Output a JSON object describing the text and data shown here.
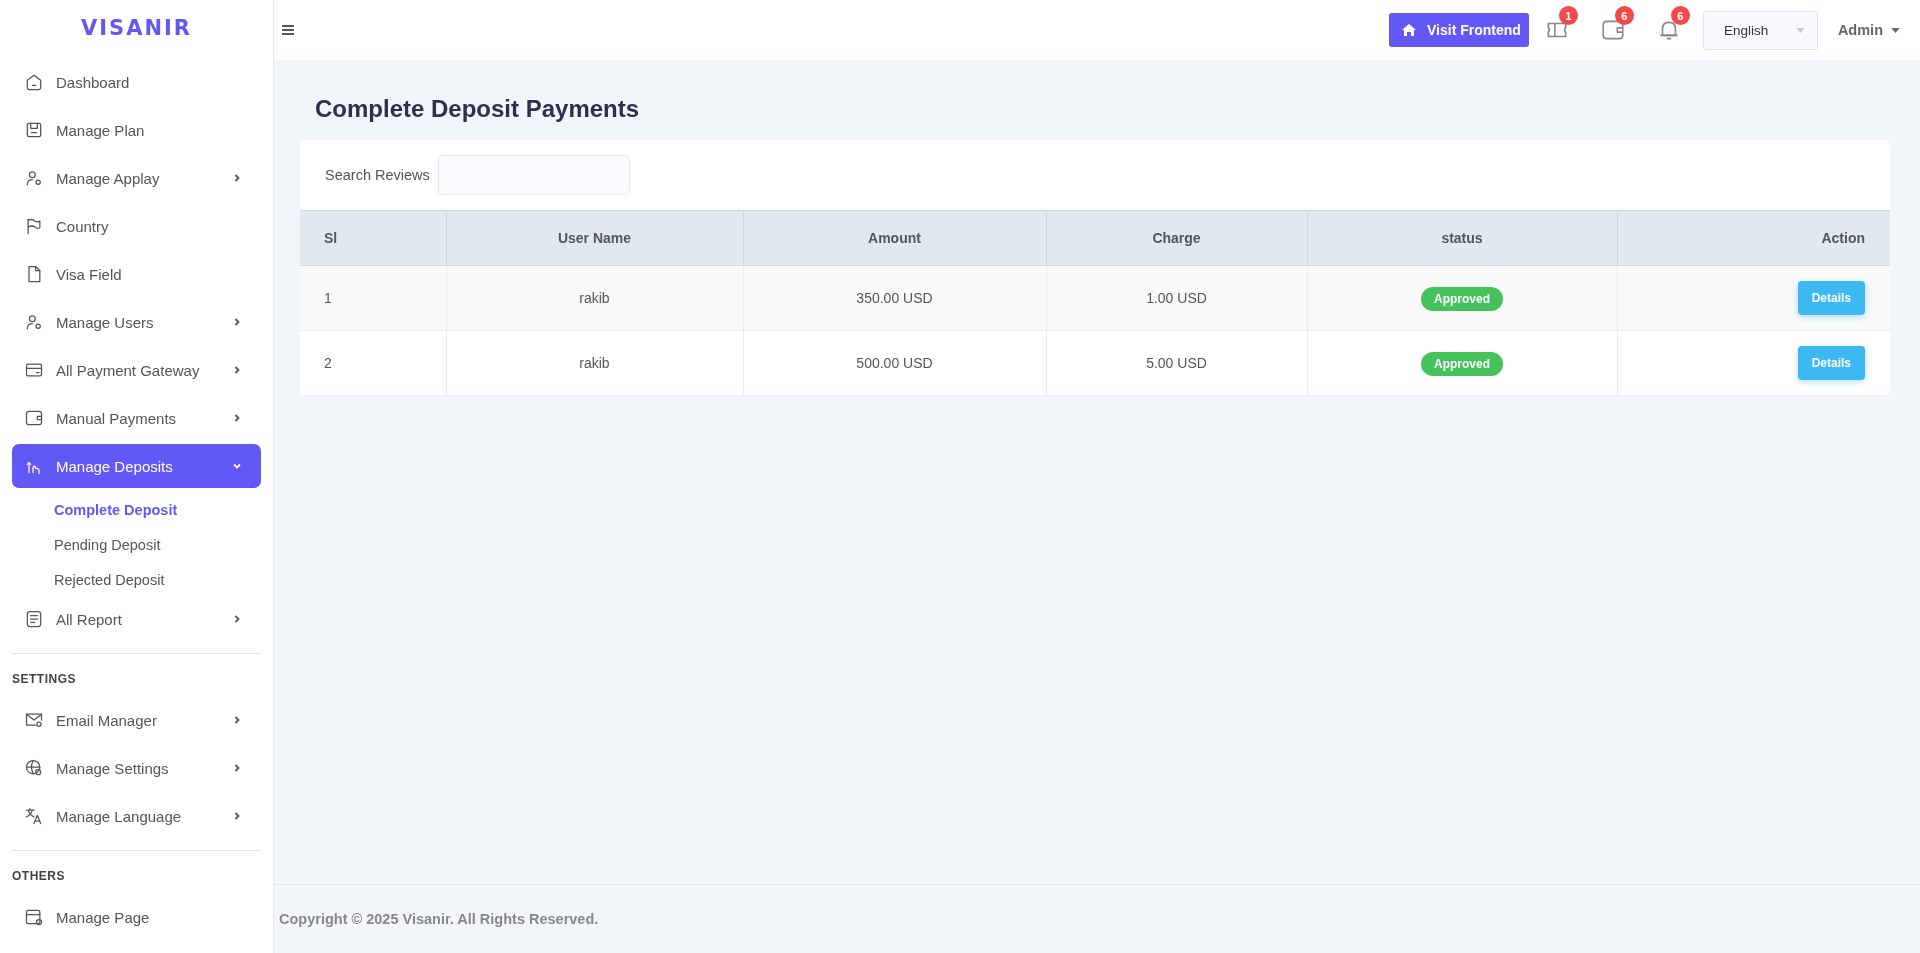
{
  "brand": "VISANIR",
  "sidebar": {
    "sections": [
      {
        "items": [
          {
            "label": "Dashboard",
            "selected": false
          },
          {
            "label": "Manage Plan",
            "selected": false
          },
          {
            "label": "Manage Applay",
            "selected": false,
            "expanded": false
          },
          {
            "label": "Country",
            "selected": false
          },
          {
            "label": "Visa Field",
            "selected": false
          },
          {
            "label": "Manage Users",
            "selected": false,
            "expanded": false
          },
          {
            "label": "All Payment Gateway",
            "selected": false,
            "expanded": false
          },
          {
            "label": "Manual Payments",
            "selected": false,
            "expanded": false
          },
          {
            "label": "Manage Deposits",
            "selected": true,
            "expanded": true,
            "children": [
              {
                "label": "Complete Deposit",
                "selected": true
              },
              {
                "label": "Pending Deposit",
                "selected": false
              },
              {
                "label": "Rejected Deposit",
                "selected": false
              }
            ]
          },
          {
            "label": "All Report",
            "selected": false,
            "expanded": false
          }
        ]
      },
      {
        "heading": "SETTINGS",
        "items": [
          {
            "label": "Email Manager",
            "selected": false,
            "expanded": false
          },
          {
            "label": "Manage Settings",
            "selected": false,
            "expanded": false
          },
          {
            "label": "Manage Language",
            "selected": false,
            "expanded": false
          }
        ]
      },
      {
        "heading": "OTHERS",
        "items": [
          {
            "label": "Manage Page",
            "selected": false
          }
        ]
      }
    ]
  },
  "topbar": {
    "visit_button": "Visit Frontend",
    "badges": [
      "1",
      "6",
      "6"
    ],
    "language": "English",
    "user": "Admin"
  },
  "page_title": "Complete Deposit Payments",
  "search": {
    "label": "Search Reviews"
  },
  "table": {
    "columns": [
      "Sl",
      "User Name",
      "Amount",
      "Charge",
      "status",
      "Action"
    ],
    "rows": [
      {
        "sl": "1",
        "user": "rakib",
        "amount": "350.00 USD",
        "charge": "1.00 USD",
        "status": "Approved",
        "action": "Details"
      },
      {
        "sl": "2",
        "user": "rakib",
        "amount": "500.00 USD",
        "charge": "5.00 USD",
        "status": "Approved",
        "action": "Details"
      }
    ]
  },
  "footer": "Copyright © 2025 Visanir. All Rights Reserved."
}
